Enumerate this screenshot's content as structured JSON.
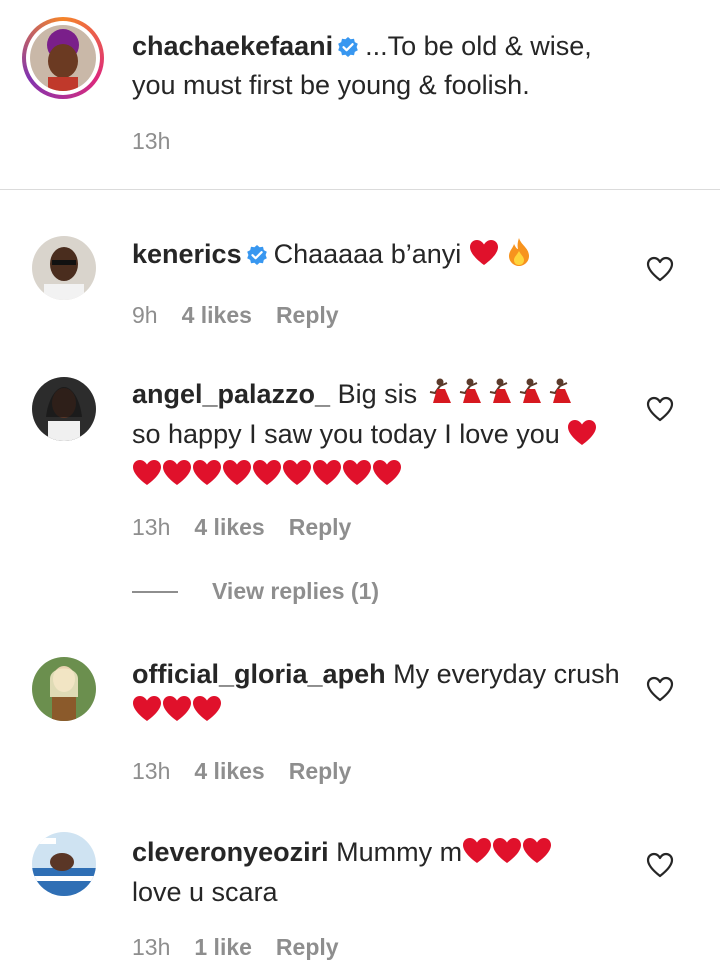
{
  "caption": {
    "username": "chachaekefaani",
    "text": "...To be old & wise, you must first be young & foolish.",
    "time": "13h"
  },
  "comments": [
    {
      "username": "kenerics",
      "text": "Chaaaaa b’anyi",
      "emoji_suffix": [
        "heart",
        "fire"
      ],
      "time": "9h",
      "likes": "4 likes",
      "reply": "Reply"
    },
    {
      "username": "angel_palazzo_",
      "text_a": "Big sis",
      "emoji_a": [
        "dancer",
        "dancer",
        "dancer",
        "dancer",
        "dancer"
      ],
      "text_b": "so happy I saw you today I love you",
      "emoji_b": [
        "heart",
        "heart",
        "heart",
        "heart",
        "heart",
        "heart",
        "heart",
        "heart",
        "heart",
        "heart"
      ],
      "time": "13h",
      "likes": "4 likes",
      "reply": "Reply",
      "view_replies": "View replies (1)"
    },
    {
      "username": "official_gloria_apeh",
      "text": "My everyday crush",
      "emoji_suffix": [
        "heart",
        "heart",
        "heart"
      ],
      "time": "13h",
      "likes": "4 likes",
      "reply": "Reply"
    },
    {
      "username": "cleveronyeoziri",
      "text_a": "Mummy m",
      "emoji_a": [
        "heart",
        "heart",
        "heart"
      ],
      "text_b": "love u scara",
      "time": "13h",
      "likes": "1 like",
      "reply": "Reply"
    }
  ],
  "colors": {
    "verified": "#3897f0",
    "heart_emoji": "#e0112b",
    "muted_text": "#8e8e8e",
    "divider": "#dbdbdb"
  }
}
